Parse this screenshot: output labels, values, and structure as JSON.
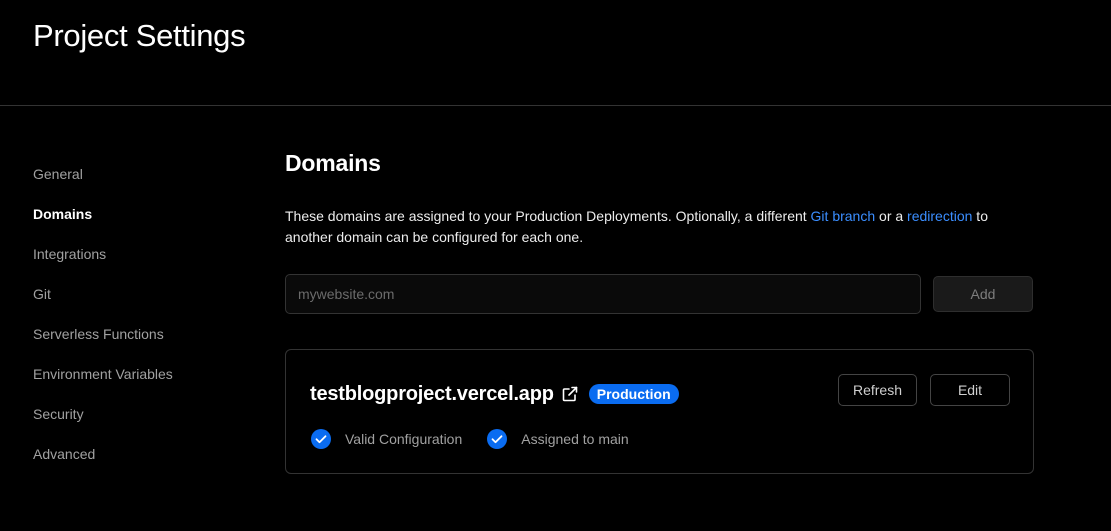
{
  "header": {
    "title": "Project Settings"
  },
  "sidebar": {
    "items": [
      {
        "label": "General"
      },
      {
        "label": "Domains"
      },
      {
        "label": "Integrations"
      },
      {
        "label": "Git"
      },
      {
        "label": "Serverless Functions"
      },
      {
        "label": "Environment Variables"
      },
      {
        "label": "Security"
      },
      {
        "label": "Advanced"
      }
    ],
    "active": "Domains"
  },
  "domains": {
    "title": "Domains",
    "description": {
      "part1": "These domains are assigned to your Production Deployments. Optionally, a different ",
      "link1": "Git branch",
      "part2": " or a ",
      "link2": "redirection",
      "part3": " to another domain can be configured for each one."
    },
    "input": {
      "placeholder": "mywebsite.com",
      "value": ""
    },
    "add_label": "Add",
    "list": [
      {
        "name": "testblogproject.vercel.app",
        "badge": "Production",
        "refresh_label": "Refresh",
        "edit_label": "Edit",
        "statuses": [
          {
            "label": "Valid Configuration"
          },
          {
            "label": "Assigned to main"
          }
        ]
      }
    ]
  },
  "colors": {
    "background": "#000000",
    "accent": "#0a6cf1",
    "link": "#3b8eff",
    "muted_text": "#a1a1a1",
    "border": "#333333"
  },
  "icons": {
    "external": "external-link-icon",
    "check": "check-circle-icon"
  }
}
